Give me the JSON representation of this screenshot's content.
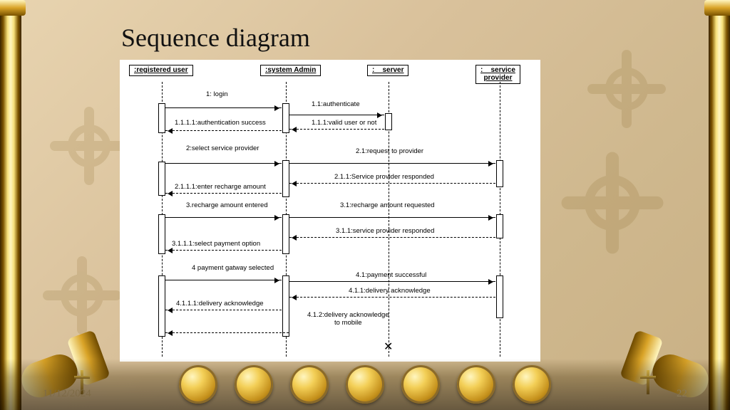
{
  "title": "Sequence diagram",
  "footer": {
    "date": "11/12/2024",
    "page": "22"
  },
  "participants": {
    "p1": ":registered user",
    "p2": ":system Admin",
    "p3": ":    server",
    "p4": ":    service\nprovider"
  },
  "messages": {
    "m1": "1: login",
    "m2": "1.1:authenticate",
    "m3": "1.1.1:valid user or not",
    "m4": "1.1.1.1:authentication success",
    "m5": "2:select service provider",
    "m6": "2.1:request to provider",
    "m7": "2.1.1:Service provider responded",
    "m8": "2.1.1.1:enter recharge amount",
    "m9": "3.recharge amount entered",
    "m10": "3.1:recharge amount requested",
    "m11": "3.1.1:service provider responded",
    "m12": "3.1.1.1:select payment option",
    "m13": "4 payment gatway selected",
    "m14": "4.1:payment successful",
    "m15": "4.1.1:delivery acknowledge",
    "m16": "4.1.1.1:delivery acknowledge",
    "m17": "4.1.2:delivery acknowledge\nto mobile"
  },
  "nav_icons": [
    "dome",
    "book",
    "scroll-book",
    "globe",
    "scroll",
    "torch",
    "compass"
  ]
}
